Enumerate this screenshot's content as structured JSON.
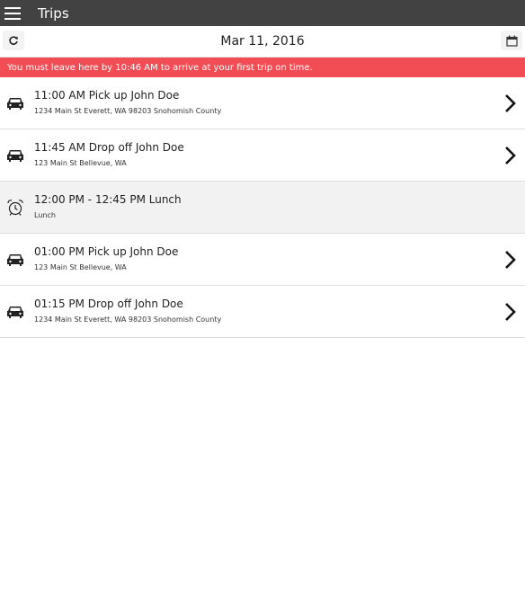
{
  "app": {
    "title": "Trips"
  },
  "date_bar": {
    "date": "Mar 11, 2016",
    "refresh_icon": "refresh-icon",
    "calendar_icon": "calendar-icon"
  },
  "alert": {
    "text": "You must leave here by 10:46 AM to arrive at your first trip on time.",
    "color": "#f24d55"
  },
  "trips": [
    {
      "icon": "car-icon",
      "title": "11:00 AM Pick up John Doe",
      "address": "1234 Main St Everett, WA 98203 Snohomish County",
      "has_chevron": true
    },
    {
      "icon": "car-icon",
      "title": "11:45 AM Drop off John Doe",
      "address": "123 Main St Bellevue, WA",
      "has_chevron": true
    },
    {
      "icon": "alarm-clock-icon",
      "title": "12:00 PM - 12:45 PM Lunch",
      "address": "Lunch",
      "has_chevron": false
    },
    {
      "icon": "car-icon",
      "title": "01:00 PM Pick up John Doe",
      "address": "123 Main St Bellevue, WA",
      "has_chevron": true
    },
    {
      "icon": "car-icon",
      "title": "01:15 PM Drop off John Doe",
      "address": "1234 Main St Everett, WA 98203 Snohomish County",
      "has_chevron": true
    }
  ],
  "colors": {
    "topbar": "#424242",
    "alert": "#f24d55",
    "break_row": "#f2f2f2"
  }
}
